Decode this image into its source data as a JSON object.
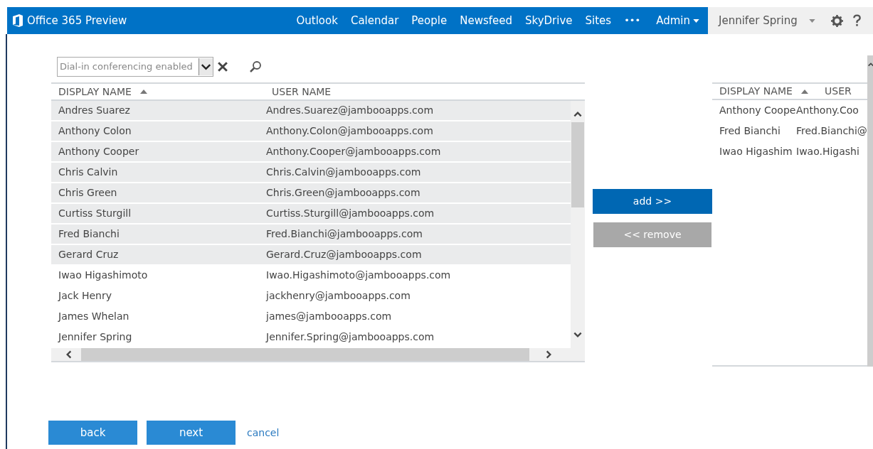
{
  "header": {
    "logo_text": "Office 365 Preview",
    "nav": [
      {
        "label": "Outlook"
      },
      {
        "label": "Calendar"
      },
      {
        "label": "People"
      },
      {
        "label": "Newsfeed"
      },
      {
        "label": "SkyDrive"
      },
      {
        "label": "Sites"
      }
    ],
    "more": "•••",
    "admin": "Admin",
    "user": "Jennifer Spring"
  },
  "filter": {
    "value": "Dial-in conferencing enabled"
  },
  "available": {
    "columns": [
      {
        "label": "DISPLAY NAME",
        "sorted": true
      },
      {
        "label": "USER NAME",
        "sorted": false
      }
    ],
    "rows": [
      {
        "display_name": "Andres Suarez",
        "user_name": "Andres.Suarez@jambooapps.com",
        "selected": true
      },
      {
        "display_name": "Anthony Colon",
        "user_name": "Anthony.Colon@jambooapps.com",
        "selected": true
      },
      {
        "display_name": "Anthony Cooper",
        "user_name": "Anthony.Cooper@jambooapps.com",
        "selected": true
      },
      {
        "display_name": "Chris Calvin",
        "user_name": "Chris.Calvin@jambooapps.com",
        "selected": true
      },
      {
        "display_name": "Chris Green",
        "user_name": "Chris.Green@jambooapps.com",
        "selected": true
      },
      {
        "display_name": "Curtiss Sturgill",
        "user_name": "Curtiss.Sturgill@jambooapps.com",
        "selected": true
      },
      {
        "display_name": "Fred Bianchi",
        "user_name": "Fred.Bianchi@jambooapps.com",
        "selected": true
      },
      {
        "display_name": "Gerard Cruz",
        "user_name": "Gerard.Cruz@jambooapps.com",
        "selected": true
      },
      {
        "display_name": "Iwao Higashimoto",
        "user_name": "Iwao.Higashimoto@jambooapps.com",
        "selected": false
      },
      {
        "display_name": "Jack Henry",
        "user_name": "jackhenry@jambooapps.com",
        "selected": false
      },
      {
        "display_name": "James Whelan",
        "user_name": "james@jambooapps.com",
        "selected": false
      },
      {
        "display_name": "Jennifer Spring",
        "user_name": "Jennifer.Spring@jambooapps.com",
        "selected": false
      }
    ]
  },
  "add_button": {
    "label": "add >>",
    "disabled": false
  },
  "remove_button": {
    "label": "<< remove",
    "disabled": true
  },
  "chosen": {
    "columns": [
      {
        "label": "DISPLAY NAME",
        "sorted": true
      },
      {
        "label": "USER",
        "sorted": false
      }
    ],
    "rows": [
      {
        "display_name": "Anthony Coope",
        "user_name": "Anthony.Coo"
      },
      {
        "display_name": "Fred Bianchi",
        "user_name": "Fred.Bianchi@"
      },
      {
        "display_name": "Iwao Higashim",
        "user_name": "Iwao.Higashi"
      }
    ]
  },
  "footer": {
    "back": "back",
    "next": "next",
    "cancel": "cancel"
  }
}
